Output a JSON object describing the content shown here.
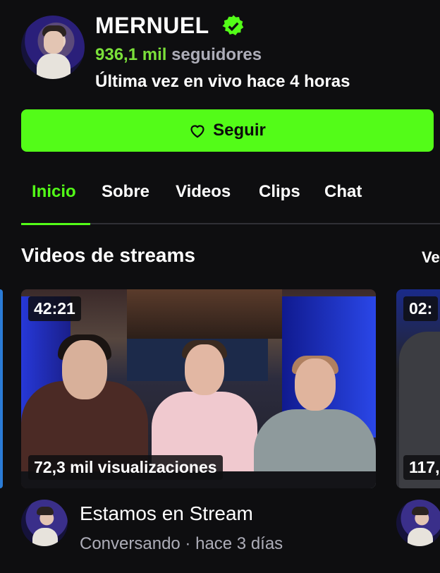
{
  "channel": {
    "name": "MERNUEL",
    "followers_count": "936,1 mil",
    "followers_label": "seguidores",
    "last_live": "Última vez en vivo hace 4 horas"
  },
  "follow_button": {
    "label": "Seguir"
  },
  "tabs": [
    {
      "label": "Inicio",
      "active": true
    },
    {
      "label": "Sobre"
    },
    {
      "label": "Videos"
    },
    {
      "label": "Clips"
    },
    {
      "label": "Chat"
    }
  ],
  "section": {
    "title": "Videos de streams",
    "see_all": "Ve"
  },
  "videos": [
    {
      "duration": "42:21",
      "views": "72,3 mil visualizaciones",
      "title": "Estamos en Stream",
      "category": "Conversando",
      "separator": " · ",
      "age": "hace 3 días"
    },
    {
      "duration": "02:",
      "views": "117,"
    }
  ],
  "colors": {
    "accent": "#53fc18",
    "background": "#0e0e10",
    "muted_text": "#adadb8"
  },
  "icons": {
    "verified": "verified-badge-icon",
    "heart": "heart-outline-icon"
  }
}
